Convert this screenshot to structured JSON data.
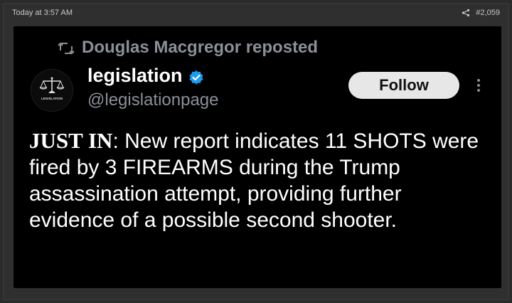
{
  "header": {
    "timestamp": "Today at 3:57 AM",
    "post_number": "#2,059",
    "share_icon": "share-icon"
  },
  "post": {
    "repost_by": "Douglas Macgregor reposted",
    "repost_icon": "repost-icon",
    "author": {
      "display_name": "legislation",
      "handle": "@legislationpage",
      "verified_icon": "verified-badge-icon",
      "avatar_text": "LEGISLATION"
    },
    "follow_label": "Follow",
    "more_icon": "more-options-icon",
    "text": {
      "prefix": "JUST IN",
      "body": ": New report indicates 11 SHOTS were fired by 3 FIREARMS during the Trump assassination attempt, providing further evidence of a possible second shooter."
    }
  },
  "colors": {
    "background": "#000000",
    "name": "#ffffff",
    "muted": "#8b9097",
    "verified": "#1d9bf0",
    "button_bg": "#e7e7e7"
  }
}
